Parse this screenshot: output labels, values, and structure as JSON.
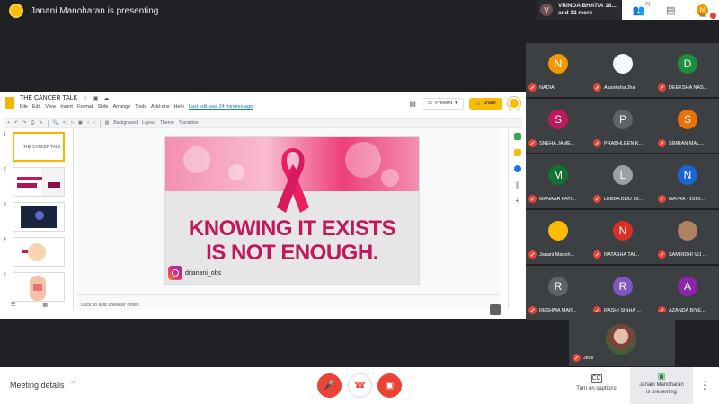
{
  "top": {
    "presenting_text": "Janani Manoharan is presenting",
    "chip_initial": "V",
    "chip_line1": "VRINDA BHATIA 18...",
    "chip_line2": "and 12 more",
    "people_count": "21",
    "you_initial": "M",
    "you_label": "You"
  },
  "slides": {
    "title": "THE CANCER TALK",
    "menu": [
      "File",
      "Edit",
      "View",
      "Insert",
      "Format",
      "Slide",
      "Arrange",
      "Tools",
      "Add-ons",
      "Help"
    ],
    "last_edit": "Last edit was 24 minutes ago",
    "present_label": "Present",
    "share_label": "Share",
    "toolbar": [
      "Background",
      "Layout",
      "Theme",
      "Transition"
    ],
    "thumb_numbers": [
      "1",
      "2",
      "3",
      "4",
      "5"
    ],
    "thumb1_title": "THE CANCER TALK",
    "headline_line1": "KNOWING IT EXISTS",
    "headline_line2": "IS NOT ENOUGH.",
    "insta_handle": "drjanani_obs",
    "speaker_notes": "Click to add speaker notes"
  },
  "participants": [
    {
      "initial": "N",
      "name": "NADIA",
      "color": "#f29900"
    },
    {
      "initial": "",
      "name": "Akanksha Jha",
      "color": "#f8f9fa"
    },
    {
      "initial": "D",
      "name": "DEEKSHA NAS...",
      "color": "#1e8e3e"
    },
    {
      "initial": "S",
      "name": "SNEHA JAME...",
      "color": "#c2185b"
    },
    {
      "initial": "P",
      "name": "PRABHLEEN K...",
      "color": "#5f6368"
    },
    {
      "initial": "S",
      "name": "SIMRAN MAL...",
      "color": "#e8710a"
    },
    {
      "initial": "M",
      "name": "MANAAR FATI...",
      "color": "#137333"
    },
    {
      "initial": "L",
      "name": "LEEBA BIJU 18...",
      "color": "#9aa0a6"
    },
    {
      "initial": "N",
      "name": "NAYRA - 1910...",
      "color": "#1967d2"
    },
    {
      "initial": "",
      "name": "Janani Manoh...",
      "color": "#fbbc04"
    },
    {
      "initial": "N",
      "name": "NATASHA TAI...",
      "color": "#d93025"
    },
    {
      "initial": "",
      "name": "SAMRIDHI VIJ ...",
      "color": "#b08060"
    },
    {
      "initial": "R",
      "name": "RESHMA MAR...",
      "color": "#5f6368"
    },
    {
      "initial": "R",
      "name": "RASHI SINHA ...",
      "color": "#7e57c2"
    },
    {
      "initial": "A",
      "name": "AZANDA BIYE...",
      "color": "#8e24aa"
    }
  ],
  "jess": {
    "name": "Jess"
  },
  "bottom": {
    "meeting_details": "Meeting details",
    "captions_label": "Turn on captions",
    "captions_icon": "CC",
    "present_now_line1": "Janani Manoharan",
    "present_now_line2": "is presenting"
  }
}
